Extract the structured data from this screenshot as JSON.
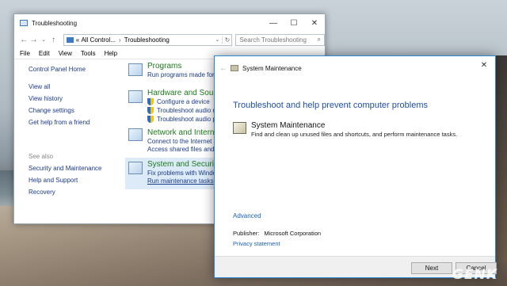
{
  "cp_window": {
    "title": "Troubleshooting",
    "controls": {
      "minimize": "—",
      "maximize": "☐",
      "close": "✕"
    },
    "address": {
      "prefix": "«",
      "path1": "All Control...",
      "sep": "›",
      "path2": "Troubleshooting"
    },
    "search_placeholder": "Search Troubleshooting",
    "menu": [
      "File",
      "Edit",
      "View",
      "Tools",
      "Help"
    ],
    "sidebar": {
      "home": "Control Panel Home",
      "links": [
        "View all",
        "View history",
        "Change settings",
        "Get help from a friend"
      ],
      "see_also_header": "See also",
      "see_also": [
        "Security and Maintenance",
        "Help and Support",
        "Recovery"
      ]
    },
    "categories": {
      "programs": {
        "title": "Programs",
        "link": "Run programs made for"
      },
      "hardware": {
        "title": "Hardware and Sour",
        "links": [
          "Configure a device",
          "Troubleshoot audio re",
          "Troubleshoot audio p"
        ]
      },
      "network": {
        "title": "Network and Intern",
        "links": [
          "Connect to the Internet",
          "Access shared files and f"
        ]
      },
      "system": {
        "title": "System and Securit",
        "links": [
          "Fix problems with Windo",
          "Run maintenance tasks"
        ]
      }
    }
  },
  "dialog": {
    "title": "System Maintenance",
    "back": "←",
    "close": "✕",
    "heading": "Troubleshoot and help prevent computer problems",
    "item_title": "System Maintenance",
    "item_desc": "Find and clean up unused files and shortcuts, and perform maintenance tasks.",
    "advanced": "Advanced",
    "publisher_label": "Publisher:",
    "publisher_value": "Microsoft Corporation",
    "privacy": "Privacy statement",
    "next": "Next",
    "cancel": "Cancel"
  },
  "watermark": "GENK",
  "colors": {
    "link": "#1a3a8a",
    "category_title": "#1e7a1e",
    "dialog_heading": "#1f4fa8",
    "dialog_border": "#2b88d8"
  }
}
